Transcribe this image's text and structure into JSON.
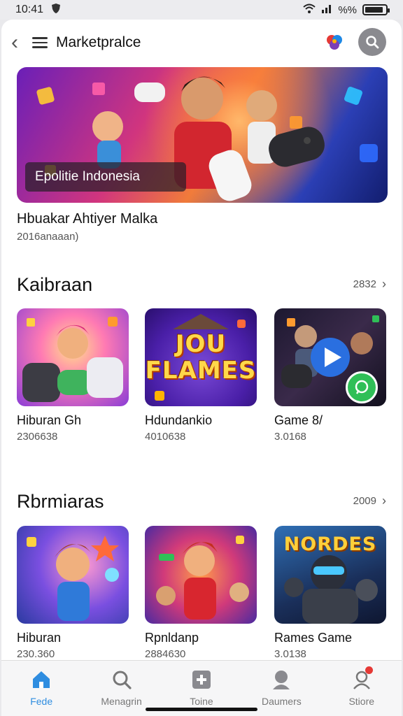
{
  "status_bar": {
    "time": "10:41",
    "signal_text": "%%"
  },
  "header": {
    "title": "Marketpralce"
  },
  "featured": {
    "caption": "Epolitie Indonesia",
    "title": "Hbuakar Ahtiyer Malka",
    "subtitle": "2016anaaan)"
  },
  "sections": [
    {
      "title": "Kaibraan",
      "count": "2832",
      "cards": [
        {
          "title": "Hiburan Gh",
          "subtitle": "2306638",
          "thumb_text": ""
        },
        {
          "title": "Hdundankio",
          "subtitle": "4010638",
          "thumb_text": "JOU FLAMES"
        },
        {
          "title": "Game 8/",
          "subtitle": "3.0168",
          "thumb_text": ""
        }
      ]
    },
    {
      "title": "Rbrmiaras",
      "count": "2009",
      "cards": [
        {
          "title": "Hiburan",
          "subtitle": "230.360",
          "thumb_text": ""
        },
        {
          "title": "Rpnldanp",
          "subtitle": "2884630",
          "thumb_text": ""
        },
        {
          "title": "Rames Game",
          "subtitle": "3.0138",
          "thumb_text": "NORDES"
        }
      ]
    }
  ],
  "tab_bar": {
    "items": [
      {
        "label": "Fede",
        "icon": "home-icon",
        "active": true
      },
      {
        "label": "Menagrin",
        "icon": "search-icon",
        "active": false
      },
      {
        "label": "Toine",
        "icon": "gamepad-icon",
        "active": false
      },
      {
        "label": "Daumers",
        "icon": "person-icon",
        "active": false
      },
      {
        "label": "Stiore",
        "icon": "profile-icon",
        "active": false
      }
    ]
  },
  "colors": {
    "accent": "#2f8de0",
    "search_button": "#8a8a8f",
    "notification": "#e53935",
    "chat": "#2fbf57"
  },
  "battery_level": 0.9
}
